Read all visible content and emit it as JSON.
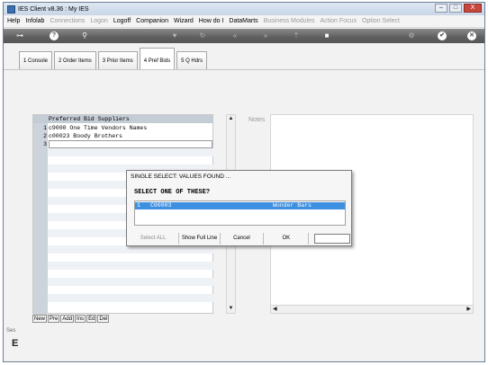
{
  "window": {
    "title": "IES Client v8.36 : My IES",
    "controls": [
      "–",
      "□",
      "X"
    ]
  },
  "menu": [
    {
      "label": "Help",
      "enabled": true
    },
    {
      "label": "Infolab",
      "enabled": true
    },
    {
      "label": "Connections",
      "enabled": false
    },
    {
      "label": "Logon",
      "enabled": false
    },
    {
      "label": "Logoff",
      "enabled": true
    },
    {
      "label": "Companion",
      "enabled": true
    },
    {
      "label": "Wizard",
      "enabled": true
    },
    {
      "label": "How do I",
      "enabled": true
    },
    {
      "label": "DataMarts",
      "enabled": true
    },
    {
      "label": "Business Modules",
      "enabled": false
    },
    {
      "label": "Action Focus",
      "enabled": false
    },
    {
      "label": "Option Select",
      "enabled": false
    }
  ],
  "toolbar": {
    "icons": [
      {
        "name": "key-icon",
        "glyph": "⊶"
      },
      {
        "name": "help-icon",
        "glyph": "?"
      },
      {
        "name": "search-icon",
        "glyph": "⚲"
      },
      {
        "name": "favourite-icon",
        "glyph": "♥"
      },
      {
        "name": "refresh-icon",
        "glyph": "↻"
      },
      {
        "name": "back-icon",
        "glyph": "«"
      },
      {
        "name": "forward-icon",
        "glyph": "»"
      },
      {
        "name": "up-icon",
        "glyph": "⇡"
      },
      {
        "name": "stop-icon",
        "glyph": "■"
      },
      {
        "name": "settings-icon",
        "glyph": "⚙"
      },
      {
        "name": "ok-icon",
        "glyph": "✔"
      },
      {
        "name": "close-icon",
        "glyph": "✕"
      }
    ]
  },
  "tabs": [
    {
      "label": "1 Console",
      "active": false
    },
    {
      "label": "2 Order Items",
      "active": false
    },
    {
      "label": "3 Prior Items",
      "active": false
    },
    {
      "label": "4 Pref Bids",
      "active": true
    },
    {
      "label": "5 Q Hdrs",
      "active": false
    }
  ],
  "grid": {
    "header": "Preferred Bid Suppliers",
    "rows": [
      {
        "num": "1",
        "text": "c9000 One Time Vendors Names"
      },
      {
        "num": "2",
        "text": "c00023 Boody Brothers"
      },
      {
        "num": "3",
        "text": ""
      }
    ],
    "buttons": [
      "New",
      "Pre",
      "Add",
      "Ins",
      "Ed",
      "Del"
    ]
  },
  "notes": {
    "label": "Notes"
  },
  "left_partial": {
    "label": "Ses",
    "icon_letter": "E"
  },
  "dialog": {
    "title": "SINGLE SELECT: VALUES FOUND ...",
    "prompt": "SELECT ONE OF THESE?",
    "items": [
      {
        "num": "1",
        "code": "C00003",
        "name": "Wonder Bars"
      }
    ],
    "buttons": {
      "select_all": "Select ALL",
      "full_line": "Show Full Line",
      "cancel": "Cancel",
      "ok": "OK"
    },
    "input_value": ""
  },
  "colors": {
    "selection": "#3d8fe0",
    "toolbar": "#5f5f5f",
    "grid_header": "#c4ccd6"
  }
}
